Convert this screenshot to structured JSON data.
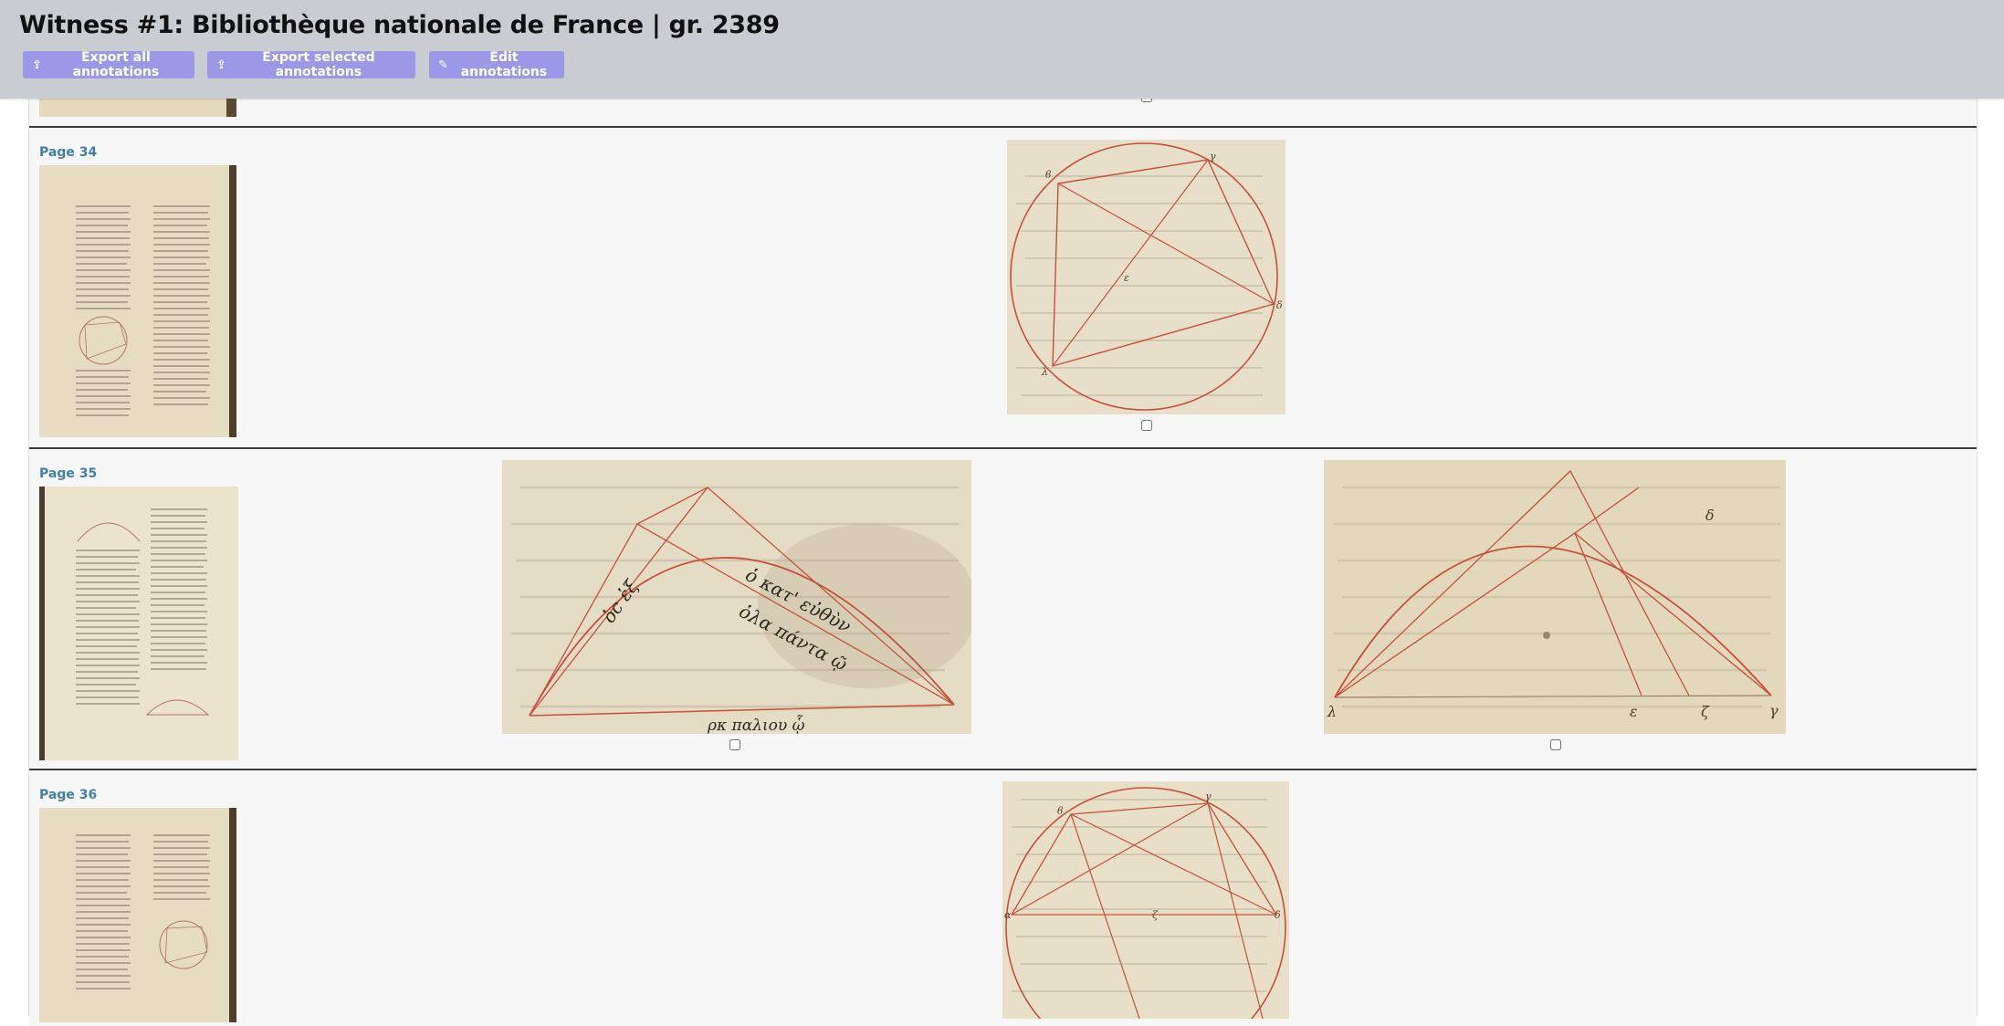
{
  "header": {
    "title": "Witness #1: Bibliothèque nationale de France | gr. 2389",
    "buttons": {
      "export_all": "Export all annotations",
      "export_selected": "Export selected annotations",
      "edit": "Edit annotations"
    },
    "icons": {
      "export_all": "export-icon",
      "export_selected": "export-icon",
      "edit": "pencil-icon"
    },
    "accent_color": "#9b98e8"
  },
  "pages": [
    {
      "label": "Page 34",
      "annotations": [
        {
          "selected": false
        }
      ]
    },
    {
      "label": "Page 35",
      "annotations": [
        {
          "selected": false
        },
        {
          "selected": false
        }
      ]
    },
    {
      "label": "Page 36",
      "annotations": [
        {
          "selected": false
        }
      ]
    }
  ],
  "colors": {
    "page_label": "#3f7fae",
    "parchment": "#e8dfc6",
    "ink_red": "#c8503a",
    "row_divider": "#3a3a3a"
  }
}
